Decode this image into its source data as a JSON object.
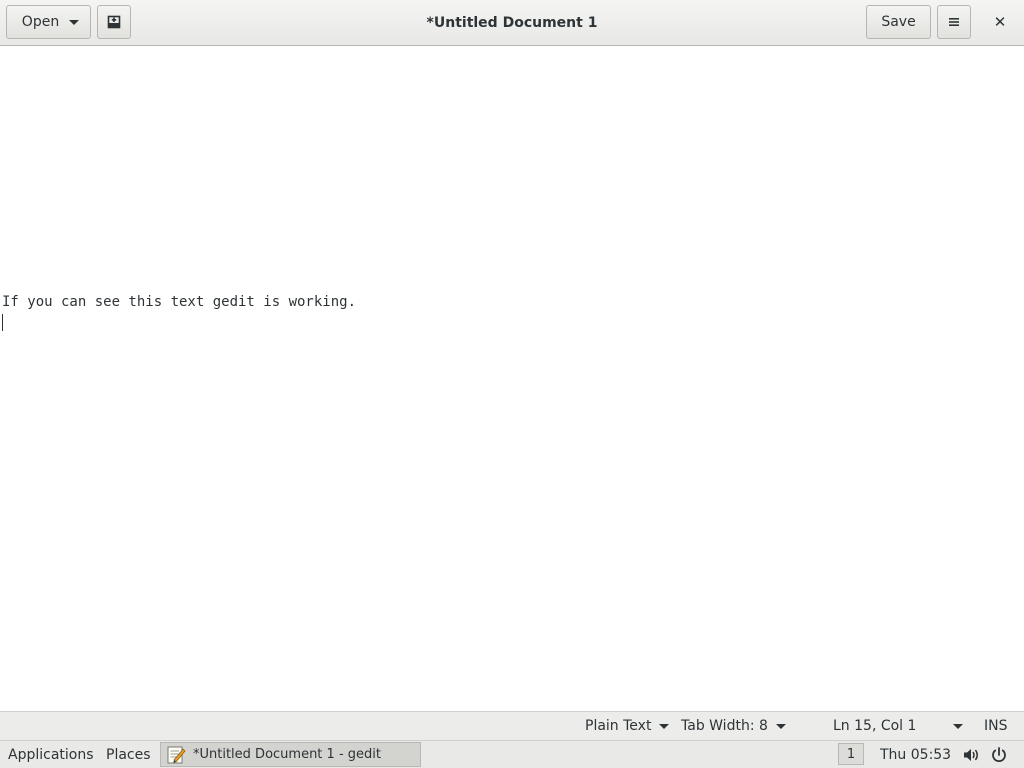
{
  "window": {
    "title": "*Untitled Document 1"
  },
  "header": {
    "open_label": "Open",
    "save_label": "Save",
    "new_doc_icon": "new-document-icon",
    "menu_icon": "hamburger-menu-icon",
    "close_glyph": "✕"
  },
  "editor": {
    "lines": [
      "If you can see this text gedit is working."
    ]
  },
  "statusbar": {
    "language": "Plain Text",
    "tab_width": "Tab Width: 8",
    "position": "Ln 15, Col 1",
    "mode": "INS"
  },
  "taskbar": {
    "applications": "Applications",
    "places": "Places",
    "task_label": "*Untitled Document 1 - gedit",
    "workspace": "1",
    "clock": "Thu 05:53",
    "volume_icon": "volume-icon",
    "power_icon": "power-icon"
  },
  "colors": {
    "headerbar_bg": "#e8e8e7",
    "text": "#2e3436",
    "editor_bg": "#ffffff"
  }
}
